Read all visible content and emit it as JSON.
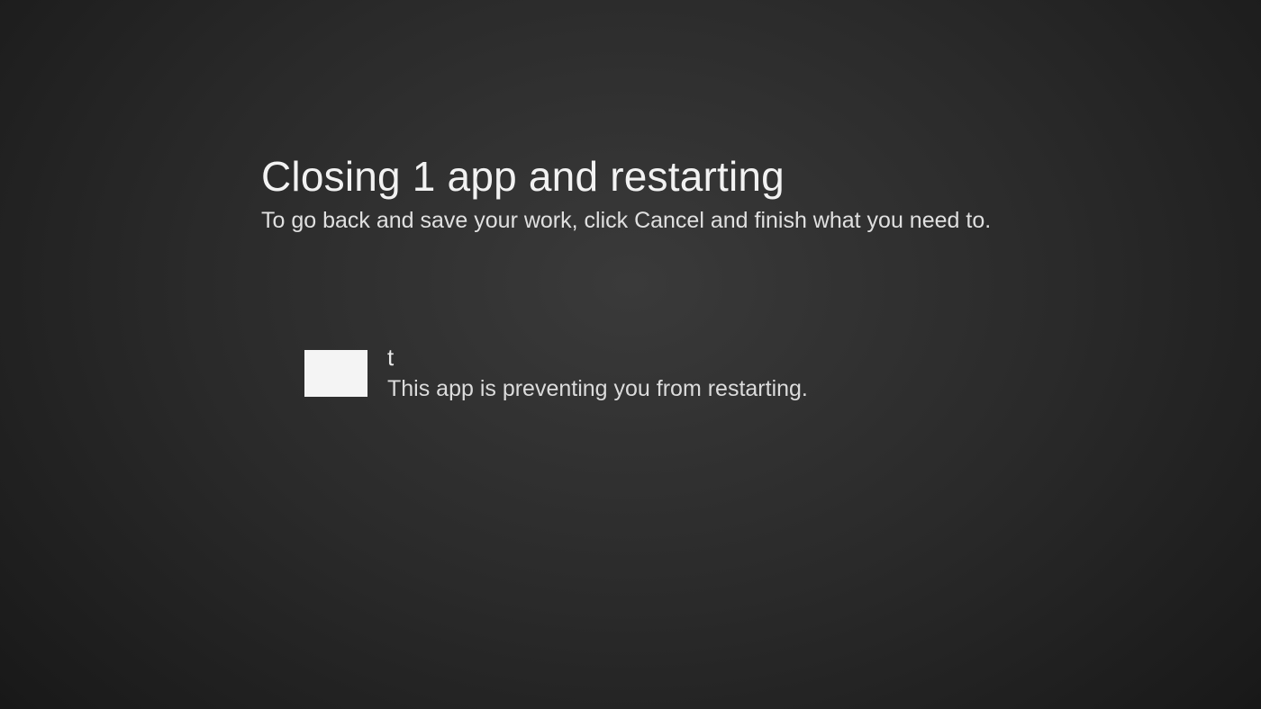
{
  "dialog": {
    "title": "Closing 1 app and restarting",
    "subtitle": "To go back and save your work, click Cancel and finish what you need to."
  },
  "apps": [
    {
      "icon": "generic-app-icon",
      "name": "t",
      "status": "This app is preventing you from restarting."
    }
  ]
}
